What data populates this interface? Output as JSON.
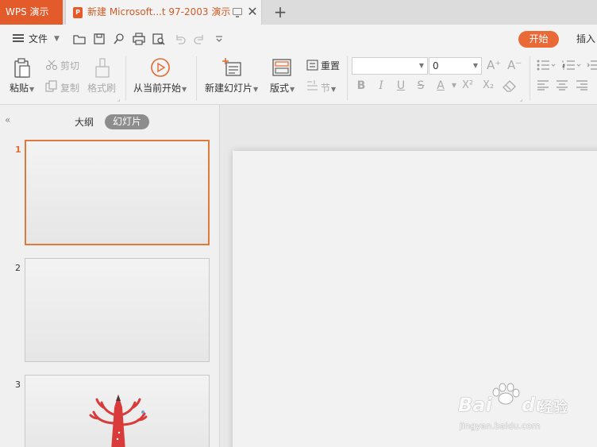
{
  "titlebar": {
    "app_tab": "WPS 演示",
    "doc_tab_title": "新建 Microsoft...t 97-2003 演示",
    "close_glyph": "✕",
    "new_tab_glyph": "+"
  },
  "menu": {
    "file_label": "文件",
    "start_tab": "开始",
    "insert_tab": "插入"
  },
  "ribbon": {
    "paste": "粘贴",
    "cut": "剪切",
    "copy": "复制",
    "format_painter": "格式刷",
    "from_current": "从当前开始",
    "new_slide": "新建幻灯片",
    "layout": "版式",
    "reset": "重置",
    "section": "节",
    "font_name": "",
    "font_size": "0",
    "bold": "B",
    "italic": "I",
    "underline": "U",
    "strike": "S",
    "font_color": "A",
    "superscript": "X²",
    "subscript": "X₂",
    "grow_font": "A⁺",
    "shrink_font": "A⁻"
  },
  "panel": {
    "outline_tab": "大纲",
    "slides_tab": "幻灯片",
    "collapse_glyph": "«",
    "slides": [
      {
        "num": "1"
      },
      {
        "num": "2"
      },
      {
        "num": "3"
      }
    ]
  },
  "watermark": {
    "brand": "Bai",
    "brand2": "du",
    "brand_cn": "经验",
    "url": "jingyan.baidu.com"
  },
  "colors": {
    "accent": "#e35a2b",
    "start_button": "#e96a37",
    "active_slide_border": "#e07a3c"
  }
}
